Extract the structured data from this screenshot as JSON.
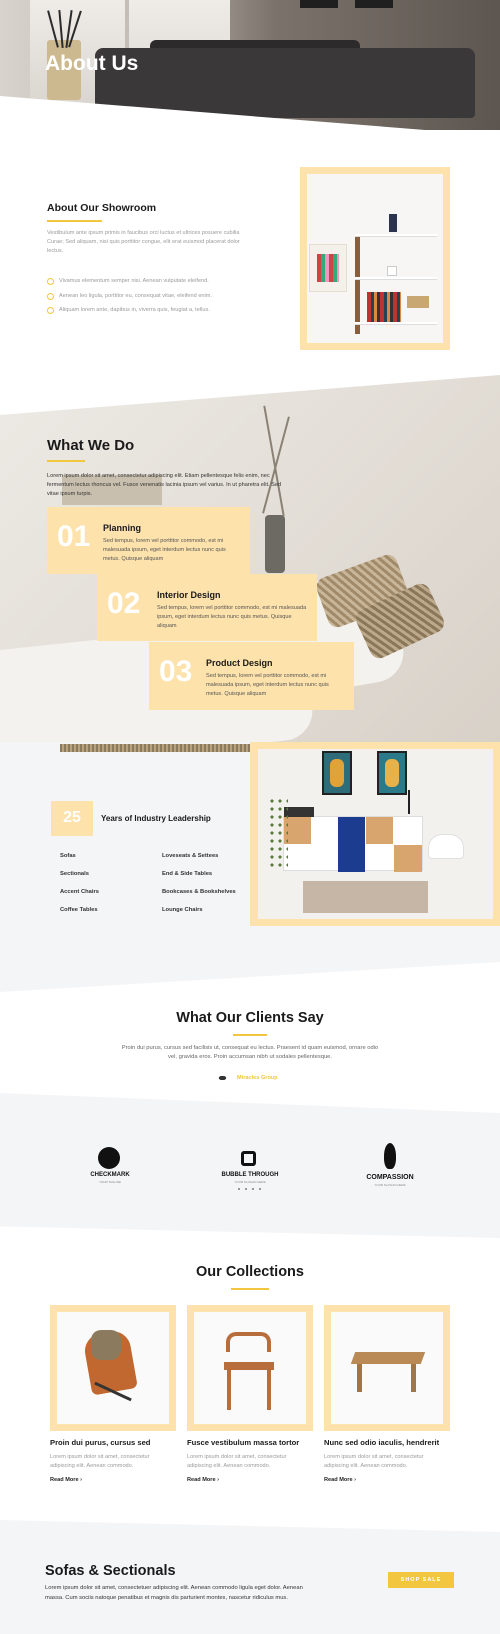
{
  "hero": {
    "title": "About Us"
  },
  "showroom": {
    "title": "About Our Showroom",
    "body": "Vestibulum ante ipsum primis in faucibus orci luctus et ultrices posuere cubilia Curae; Sed aliquam, nisi quis porttitor congue, elit erat euismod placerat dolor lectus.",
    "bullets": [
      "Vivamus elementum semper nisi. Aenean vulputate eleifend.",
      "Aenean leo ligula, porttitor eu, consequat vitae, eleifend enim.",
      "Aliquam lorem ante, dapibus in, viverra quis, feugiat a, tellus."
    ]
  },
  "what_we_do": {
    "title": "What We Do",
    "body": "Lorem ipsum dolor sit amet, consectetur adipiscing elit. Etiam pellentesque felis enim, nec fermentum lectus rhoncus vel. Fusce venenatis lacinia ipsum vel varius. In ut pharetra elit. Sed vitae ipsum turpis.",
    "steps": [
      {
        "num": "01",
        "title": "Planning",
        "text": "Sed tempus, lorem vel porttitor commodo, est mi malesuada ipsum, eget interdum lectus nunc quis metus. Quisque aliquam"
      },
      {
        "num": "02",
        "title": "Interior Design",
        "text": "Sed tempus, lorem vel porttitor commodo, est mi malesuada ipsum, eget interdum lectus nunc quis metus. Quisque aliquam"
      },
      {
        "num": "03",
        "title": "Product Design",
        "text": "Sed tempus, lorem vel porttitor commodo, est mi malesuada ipsum, eget interdum lectus nunc quis metus. Quisque aliquam"
      }
    ]
  },
  "years": {
    "number": "25",
    "label": "Years of Industry Leadership",
    "categories_left": [
      "Sofas",
      "Sectionals",
      "Accent Chairs",
      "Coffee Tables"
    ],
    "categories_right": [
      "Loveseats & Settees",
      "End & Side Tables",
      "Bookcases & Bookshelves",
      "Lounge Chairs"
    ]
  },
  "clients": {
    "title": "What Our Clients Say",
    "quote": "Proin dui purus, cursus sed facilisis ut, consequat eu lectus. Praesent id quam euismod, ornare odio vel, gravida eros. Proin accumsan nibh ut sodales pellentesque.",
    "author": "Miracles Group"
  },
  "logos": [
    {
      "name": "CHECKMARK",
      "tagline": "YOUR TAGLINE"
    },
    {
      "name": "BUBBLE THROUGH",
      "tagline": "YOUR SLOGAN HERE"
    },
    {
      "name": "COMPASSION",
      "tagline": "YOUR SLOGAN HERE"
    }
  ],
  "collections": {
    "title": "Our Collections",
    "items": [
      {
        "title": "Proin dui purus, cursus sed",
        "desc": "Lorem ipsum dolor sit amet, consectetur adipiscing elit. Aenean commodo.",
        "link": "Read More"
      },
      {
        "title": "Fusce vestibulum massa tortor",
        "desc": "Lorem ipsum dolor sit amet, consectetur adipiscing elit. Aenean commodo.",
        "link": "Read More"
      },
      {
        "title": "Nunc sed odio iaculis, hendrerit",
        "desc": "Lorem ipsum dolor sit amet, consectetur adipiscing elit. Aenean commodo.",
        "link": "Read More"
      }
    ]
  },
  "sofas": {
    "title": "Sofas & Sectionals",
    "body": "Lorem ipsum dolor sit amet, consectetuer adipiscing elit. Aenean commodo ligula eget dolor. Aenean massa. Cum sociis natoque penatibus et magnis dis parturient montes, nascetur ridiculus mus.",
    "button": "SHOP SALE"
  },
  "colors": {
    "accent": "#f3c63f",
    "card": "#fde2ac",
    "section_grey": "#f4f5f7"
  }
}
